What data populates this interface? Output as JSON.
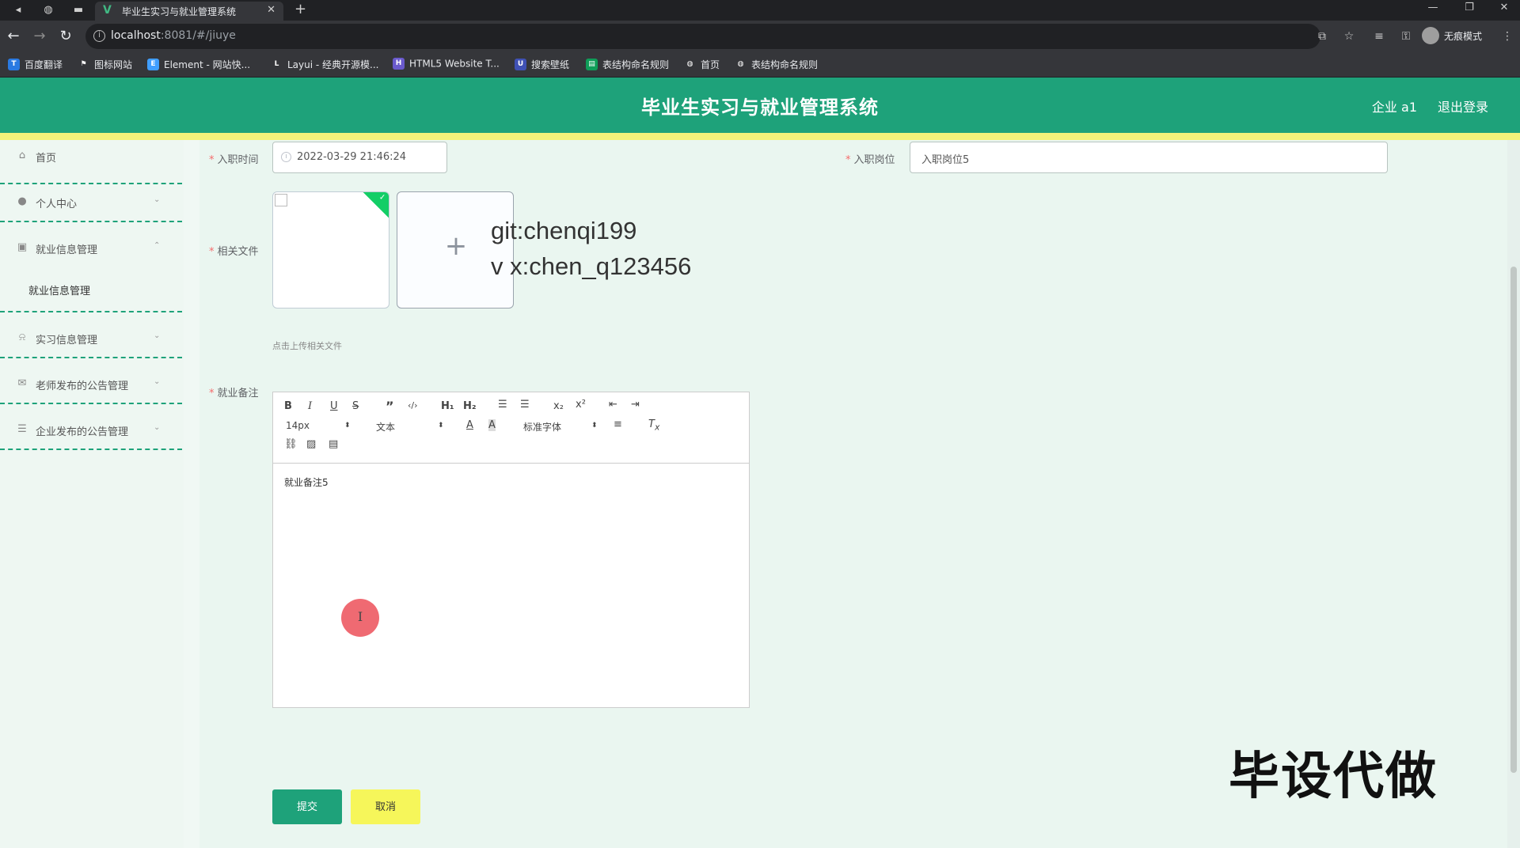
{
  "browser": {
    "tab_title": "毕业生实习与就业管理系统",
    "tab_favicon": "V",
    "url_host": "localhost",
    "url_rest": ":8081/#/jiuye",
    "incognito_label": "无痕模式",
    "bookmarks": [
      {
        "label": "百度翻译",
        "icon": "translate-icon",
        "color": "#2a7ae2",
        "glyph": "T"
      },
      {
        "label": "图标网站",
        "icon": "flag-icon",
        "color": "#555555",
        "glyph": "⚑"
      },
      {
        "label": "Element - 网站快...",
        "icon": "element-icon",
        "color": "#409eff",
        "glyph": "E"
      },
      {
        "label": "Layui - 经典开源模...",
        "icon": "layui-icon",
        "color": "#444444",
        "glyph": "L"
      },
      {
        "label": "HTML5 Website T...",
        "icon": "html5-icon",
        "color": "#6a5acd",
        "glyph": "H"
      },
      {
        "label": "搜索壁纸",
        "icon": "wallpaper-icon",
        "color": "#3f51b5",
        "glyph": "U"
      },
      {
        "label": "表结构命名规则",
        "icon": "sheet-icon",
        "color": "#0f9d58",
        "glyph": "▤"
      },
      {
        "label": "首页",
        "icon": "globe-icon",
        "color": "#555555",
        "glyph": "◍"
      },
      {
        "label": "表结构命名规则",
        "icon": "globe-icon",
        "color": "#555555",
        "glyph": "◍"
      }
    ]
  },
  "header": {
    "title": "毕业生实习与就业管理系统",
    "user": "企业 a1",
    "logout": "退出登录"
  },
  "sidebar": {
    "items": [
      {
        "label": "首页",
        "icon": "home-icon"
      },
      {
        "label": "个人中心",
        "icon": "user-icon"
      },
      {
        "label": "就业信息管理",
        "icon": "clipboard-icon"
      },
      {
        "label": "实习信息管理",
        "icon": "bell-icon"
      },
      {
        "label": "老师发布的公告管理",
        "icon": "mail-icon"
      },
      {
        "label": "企业发布的公告管理",
        "icon": "sliders-icon"
      }
    ],
    "submenu": "就业信息管理"
  },
  "form": {
    "join_time_label": "入职时间",
    "join_time_value": "2022-03-29 21:46:24",
    "post_label": "入职岗位",
    "post_value": "入职岗位5",
    "files_label": "相关文件",
    "upload_tip": "点击上传相关文件",
    "remark_label": "就业备注",
    "remark_value": "就业备注5",
    "submit": "提交",
    "cancel": "取消"
  },
  "editor": {
    "font_size": "14px",
    "block_type": "文本",
    "font_family": "标准字体"
  },
  "overlay": {
    "line1": "git:chenqi199",
    "line2": "v x:chen_q123456",
    "watermark": "毕设代做"
  },
  "colors": {
    "brand": "#1ea27a",
    "stripe": "#f2f27a",
    "cancel": "#f6f65a"
  }
}
